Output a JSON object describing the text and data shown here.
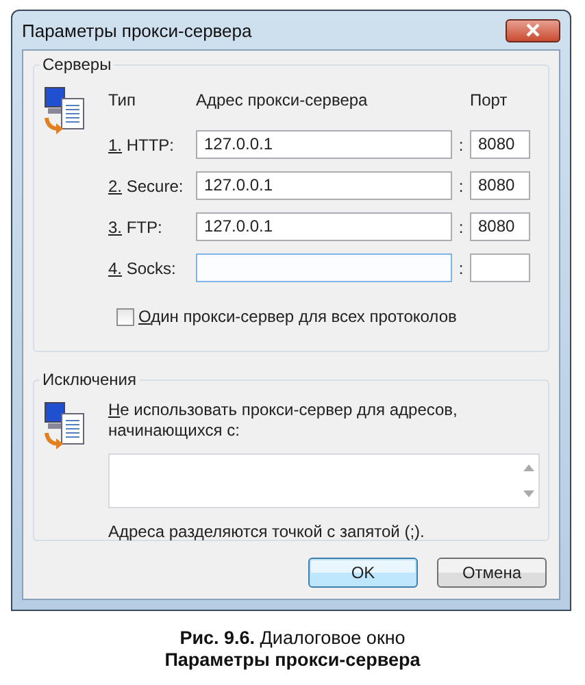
{
  "window": {
    "title": "Параметры прокси-сервера"
  },
  "servers": {
    "title": "Серверы",
    "col_type": "Тип",
    "col_address": "Адрес прокси-сервера",
    "col_port": "Порт",
    "rows": [
      {
        "label": "1. HTTP:",
        "address": "127.0.0.1",
        "separator": ":",
        "port": "8080",
        "focused": false
      },
      {
        "label": "2. Secure:",
        "address": "127.0.0.1",
        "separator": ":",
        "port": "8080",
        "focused": false
      },
      {
        "label": "3. FTP:",
        "address": "127.0.0.1",
        "separator": ":",
        "port": "8080",
        "focused": false
      },
      {
        "label": "4. Socks:",
        "separator": ":",
        "focused": true
      }
    ],
    "same_proxy": {
      "label": "Один прокси-сервер для всех протоколов",
      "checked": false
    }
  },
  "exceptions": {
    "title": "Исключения",
    "label": "Не использовать прокси-сервер для адресов, начинающихся с:",
    "note": "Адреса разделяются точкой с запятой (;)."
  },
  "buttons": [
    {
      "label": "OK",
      "default": true
    },
    {
      "label": "Отмена",
      "default": false
    }
  ],
  "caption": {
    "line_1": "**Рис. 9.6.** Диалоговое окно",
    "line_2": "Параметры прокси-сервера"
  }
}
